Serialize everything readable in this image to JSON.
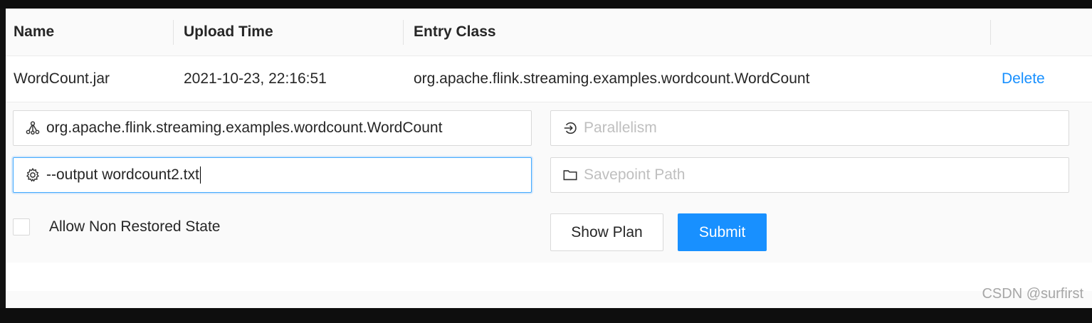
{
  "table": {
    "headers": [
      "Name",
      "Upload Time",
      "Entry Class"
    ],
    "row": {
      "name": "WordCount.jar",
      "upload_time": "2021-10-23, 22:16:51",
      "entry_class": "org.apache.flink.streaming.examples.wordcount.WordCount",
      "action": "Delete"
    }
  },
  "form": {
    "entry_class_value": "org.apache.flink.streaming.examples.wordcount.WordCount",
    "program_args_value": "--output wordcount2.txt",
    "parallelism_placeholder": "Parallelism",
    "savepoint_placeholder": "Savepoint Path",
    "allow_non_restored_label": "Allow Non Restored State",
    "show_plan_label": "Show Plan",
    "submit_label": "Submit"
  },
  "watermark": "CSDN @surfirst",
  "colors": {
    "primary": "#1890ff",
    "link": "#1890ff",
    "border": "#d9d9d9",
    "background": "#fafafa"
  },
  "icons": [
    "cluster-icon",
    "gear-icon",
    "login-icon",
    "folder-icon"
  ]
}
